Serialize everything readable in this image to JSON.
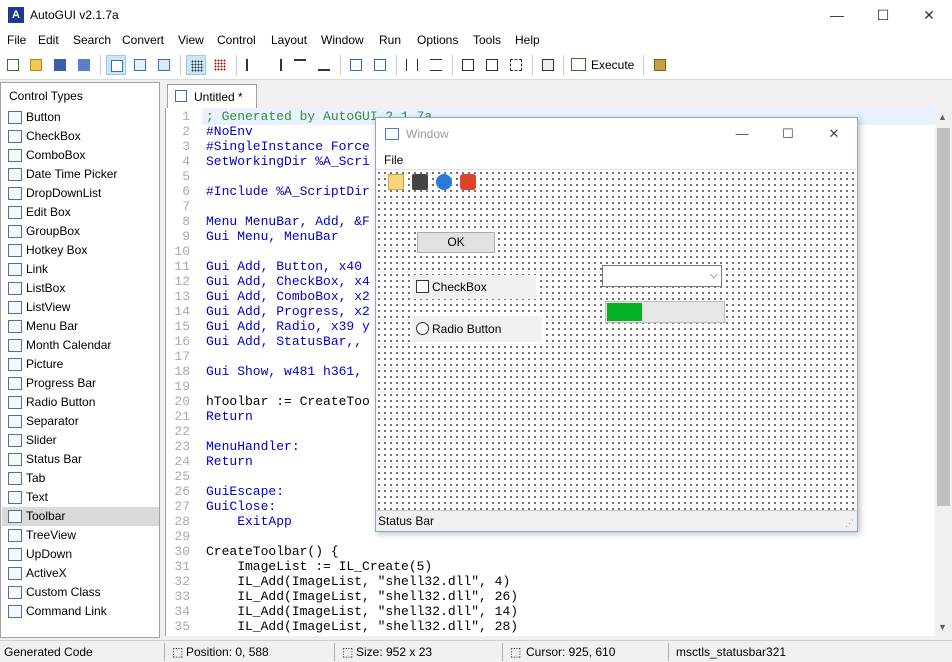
{
  "app": {
    "title": "AutoGUI v2.1.7a"
  },
  "window_controls": {
    "minimize": "—",
    "maximize": "☐",
    "close": "✕"
  },
  "menubar": [
    "File",
    "Edit",
    "Search",
    "Convert",
    "View",
    "Control",
    "Layout",
    "Window",
    "Run",
    "Options",
    "Tools",
    "Help"
  ],
  "toolbar": {
    "execute_label": "Execute"
  },
  "sidebar": {
    "header": "Control Types",
    "items": [
      {
        "label": "Button",
        "icon": "button-icon"
      },
      {
        "label": "CheckBox",
        "icon": "checkbox-icon"
      },
      {
        "label": "ComboBox",
        "icon": "combobox-icon"
      },
      {
        "label": "Date Time Picker",
        "icon": "date-time-icon"
      },
      {
        "label": "DropDownList",
        "icon": "dropdown-icon"
      },
      {
        "label": "Edit Box",
        "icon": "edit-box-icon"
      },
      {
        "label": "GroupBox",
        "icon": "groupbox-icon"
      },
      {
        "label": "Hotkey Box",
        "icon": "hotkey-icon"
      },
      {
        "label": "Link",
        "icon": "link-icon"
      },
      {
        "label": "ListBox",
        "icon": "listbox-icon"
      },
      {
        "label": "ListView",
        "icon": "listview-icon"
      },
      {
        "label": "Menu Bar",
        "icon": "menubar-icon"
      },
      {
        "label": "Month Calendar",
        "icon": "calendar-icon"
      },
      {
        "label": "Picture",
        "icon": "picture-icon"
      },
      {
        "label": "Progress Bar",
        "icon": "progress-icon"
      },
      {
        "label": "Radio Button",
        "icon": "radio-icon"
      },
      {
        "label": "Separator",
        "icon": "separator-icon"
      },
      {
        "label": "Slider",
        "icon": "slider-icon"
      },
      {
        "label": "Status Bar",
        "icon": "statusbar-icon"
      },
      {
        "label": "Tab",
        "icon": "tab-icon"
      },
      {
        "label": "Text",
        "icon": "text-icon"
      },
      {
        "label": "Toolbar",
        "icon": "toolbar-icon",
        "selected": true
      },
      {
        "label": "TreeView",
        "icon": "treeview-icon"
      },
      {
        "label": "UpDown",
        "icon": "updown-icon"
      },
      {
        "label": "ActiveX",
        "icon": "activex-icon"
      },
      {
        "label": "Custom Class",
        "icon": "custom-class-icon"
      },
      {
        "label": "Command Link",
        "icon": "command-link-icon"
      }
    ]
  },
  "editor": {
    "tab_label": "Untitled  *",
    "lines": [
      "; Generated by AutoGUI 2.1.7a",
      "#NoEnv",
      "#SingleInstance Force",
      "SetWorkingDir %A_Scri",
      "",
      "#Include %A_ScriptDir",
      "",
      "Menu MenuBar, Add, &F",
      "Gui Menu, MenuBar",
      "",
      "Gui Add, Button, x40 ",
      "Gui Add, CheckBox, x4",
      "Gui Add, ComboBox, x2",
      "Gui Add, Progress, x2",
      "Gui Add, Radio, x39 y",
      "Gui Add, StatusBar,, ",
      "",
      "Gui Show, w481 h361, ",
      "",
      "hToolbar := CreateToo",
      "Return",
      "",
      "MenuHandler:",
      "Return",
      "",
      "GuiEscape:",
      "GuiClose:",
      "    ExitApp",
      "",
      "CreateToolbar() {",
      "    ImageList := IL_Create(5)",
      "    IL_Add(ImageList, \"shell32.dll\", 4)",
      "    IL_Add(ImageList, \"shell32.dll\", 26)",
      "    IL_Add(ImageList, \"shell32.dll\", 14)",
      "    IL_Add(ImageList, \"shell32.dll\", 28)"
    ]
  },
  "gui_window": {
    "title": "Window",
    "menu_file": "File",
    "ok_label": "OK",
    "checkbox_label": "CheckBox",
    "radio_label": "Radio Button",
    "progress_value": 0.3,
    "statusbar_text": "Status Bar"
  },
  "statusbar": {
    "mode": "Generated Code",
    "position": "Position: 0, 588",
    "size": "Size: 952 x 23",
    "cursor": "Cursor: 925, 610",
    "class": "msctls_statusbar321"
  },
  "colors": {
    "progress_fill": "#06b025",
    "selection": "#d9d9d9",
    "comment": "#3a8a3a",
    "keyword": "#0000cc"
  }
}
